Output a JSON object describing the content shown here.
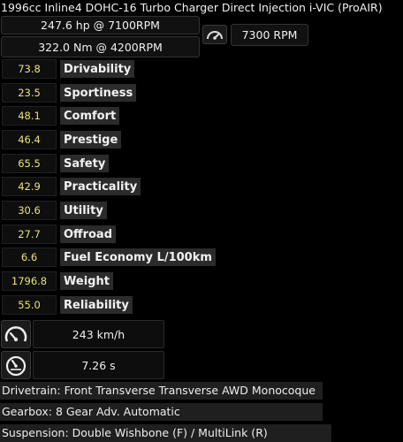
{
  "engine": {
    "title": "1996cc Inline4 DOHC-16 Turbo Charger Direct Injection i-VIC (ProAIR)",
    "power": "247.6 hp @ 7100RPM",
    "torque": "322.0 Nm @ 4200RPM",
    "redline": "7300 RPM",
    "redline_icon": "tachometer-icon"
  },
  "stats": [
    {
      "value": "73.8",
      "label": "Drivability"
    },
    {
      "value": "23.5",
      "label": "Sportiness"
    },
    {
      "value": "48.1",
      "label": "Comfort"
    },
    {
      "value": "46.4",
      "label": "Prestige"
    },
    {
      "value": "65.5",
      "label": "Safety"
    },
    {
      "value": "42.9",
      "label": "Practicality"
    },
    {
      "value": "30.6",
      "label": "Utility"
    },
    {
      "value": "27.7",
      "label": "Offroad"
    },
    {
      "value": "6.6",
      "label": "Fuel Economy L/100km"
    },
    {
      "value": "1796.8",
      "label": "Weight"
    },
    {
      "value": "55.0",
      "label": "Reliability"
    }
  ],
  "performance": {
    "top_speed": "243 km/h",
    "top_speed_icon": "speedometer-icon",
    "acceleration": "7.26 s",
    "acceleration_icon": "stopwatch-gauge-icon"
  },
  "drivetrain": "Drivetrain: Front Transverse Transverse AWD Monocoque",
  "gearbox": "Gearbox: 8 Gear Adv. Automatic",
  "suspension": "Suspension: Double Wishbone (F) / MultiLink (R)",
  "colors": {
    "stat_value": "#e7e37b",
    "label_bg": "#2b2b2b",
    "background": "#000000"
  }
}
